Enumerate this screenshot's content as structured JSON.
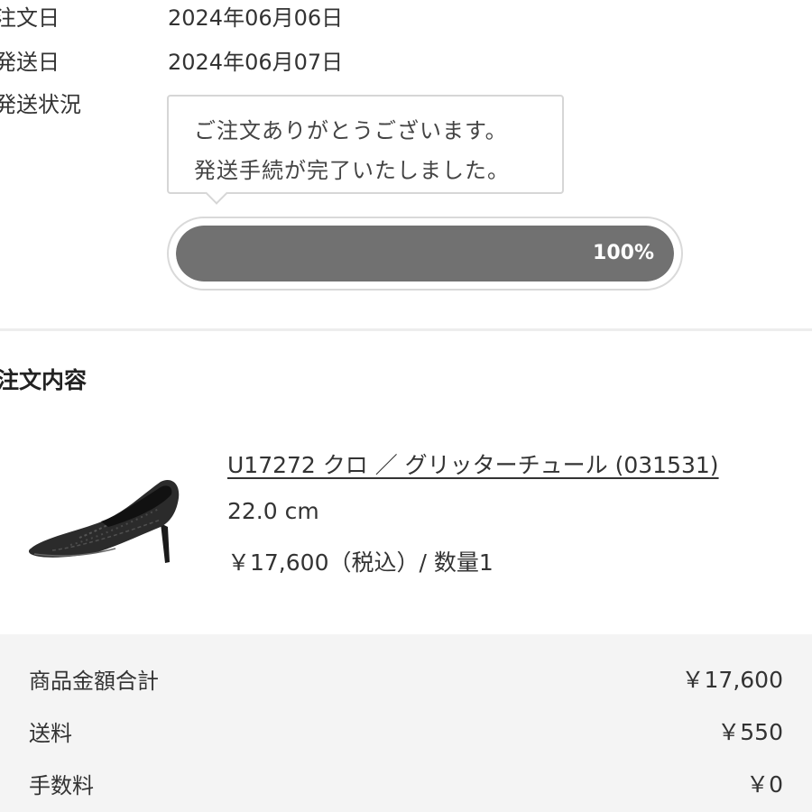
{
  "order": {
    "order_date_label": "注文日",
    "order_date": "2024年06月06日",
    "ship_date_label": "発送日",
    "ship_date": "2024年06月07日",
    "status_label": "発送状況",
    "status_message_line1": "ご注文ありがとうございます。",
    "status_message_line2": "発送手続が完了いたしました。",
    "progress_text": "100%",
    "progress_fraction": 1.0
  },
  "details": {
    "title": "注文内容",
    "item": {
      "image_icon": "pump-shoe-image",
      "name": "U17272 クロ ／ グリッターチュール (031531)",
      "size": "22.0 cm",
      "price_line": "￥17,600（税込）/ 数量1"
    }
  },
  "summary": {
    "subtotal_label": "商品金額合計",
    "subtotal_value": "￥17,600",
    "shipping_label": "送料",
    "shipping_value": "￥550",
    "fee_label": "手数料",
    "fee_value": "￥0"
  },
  "colors": {
    "progress_fill": "#717171",
    "summary_bg": "#f4f4f4"
  }
}
